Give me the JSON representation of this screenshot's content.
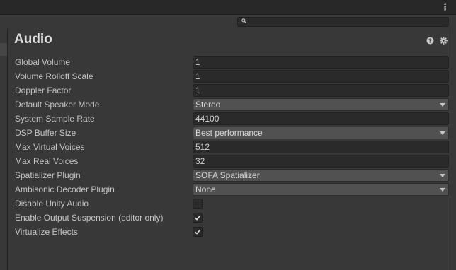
{
  "window": {
    "menu_icon": "kebab-menu-icon",
    "search": {
      "value": "",
      "placeholder": ""
    }
  },
  "panel": {
    "title": "Audio",
    "help_icon": "help-icon",
    "settings_icon": "gear-icon"
  },
  "settings": [
    {
      "label": "Global Volume",
      "kind": "text",
      "value": "1"
    },
    {
      "label": "Volume Rolloff Scale",
      "kind": "text",
      "value": "1"
    },
    {
      "label": "Doppler Factor",
      "kind": "text",
      "value": "1"
    },
    {
      "label": "Default Speaker Mode",
      "kind": "dropdown",
      "value": "Stereo"
    },
    {
      "label": "System Sample Rate",
      "kind": "text",
      "value": "44100"
    },
    {
      "label": "DSP Buffer Size",
      "kind": "dropdown",
      "value": "Best performance"
    },
    {
      "label": "Max Virtual Voices",
      "kind": "text",
      "value": "512"
    },
    {
      "label": "Max Real Voices",
      "kind": "text",
      "value": "32"
    },
    {
      "label": "Spatializer Plugin",
      "kind": "dropdown",
      "value": "SOFA Spatializer"
    },
    {
      "label": "Ambisonic Decoder Plugin",
      "kind": "dropdown",
      "value": "None"
    },
    {
      "label": "Disable Unity Audio",
      "kind": "checkbox",
      "checked": false
    },
    {
      "label": "Enable Output Suspension (editor only)",
      "kind": "checkbox",
      "checked": true
    },
    {
      "label": "Virtualize Effects",
      "kind": "checkbox",
      "checked": true
    }
  ]
}
